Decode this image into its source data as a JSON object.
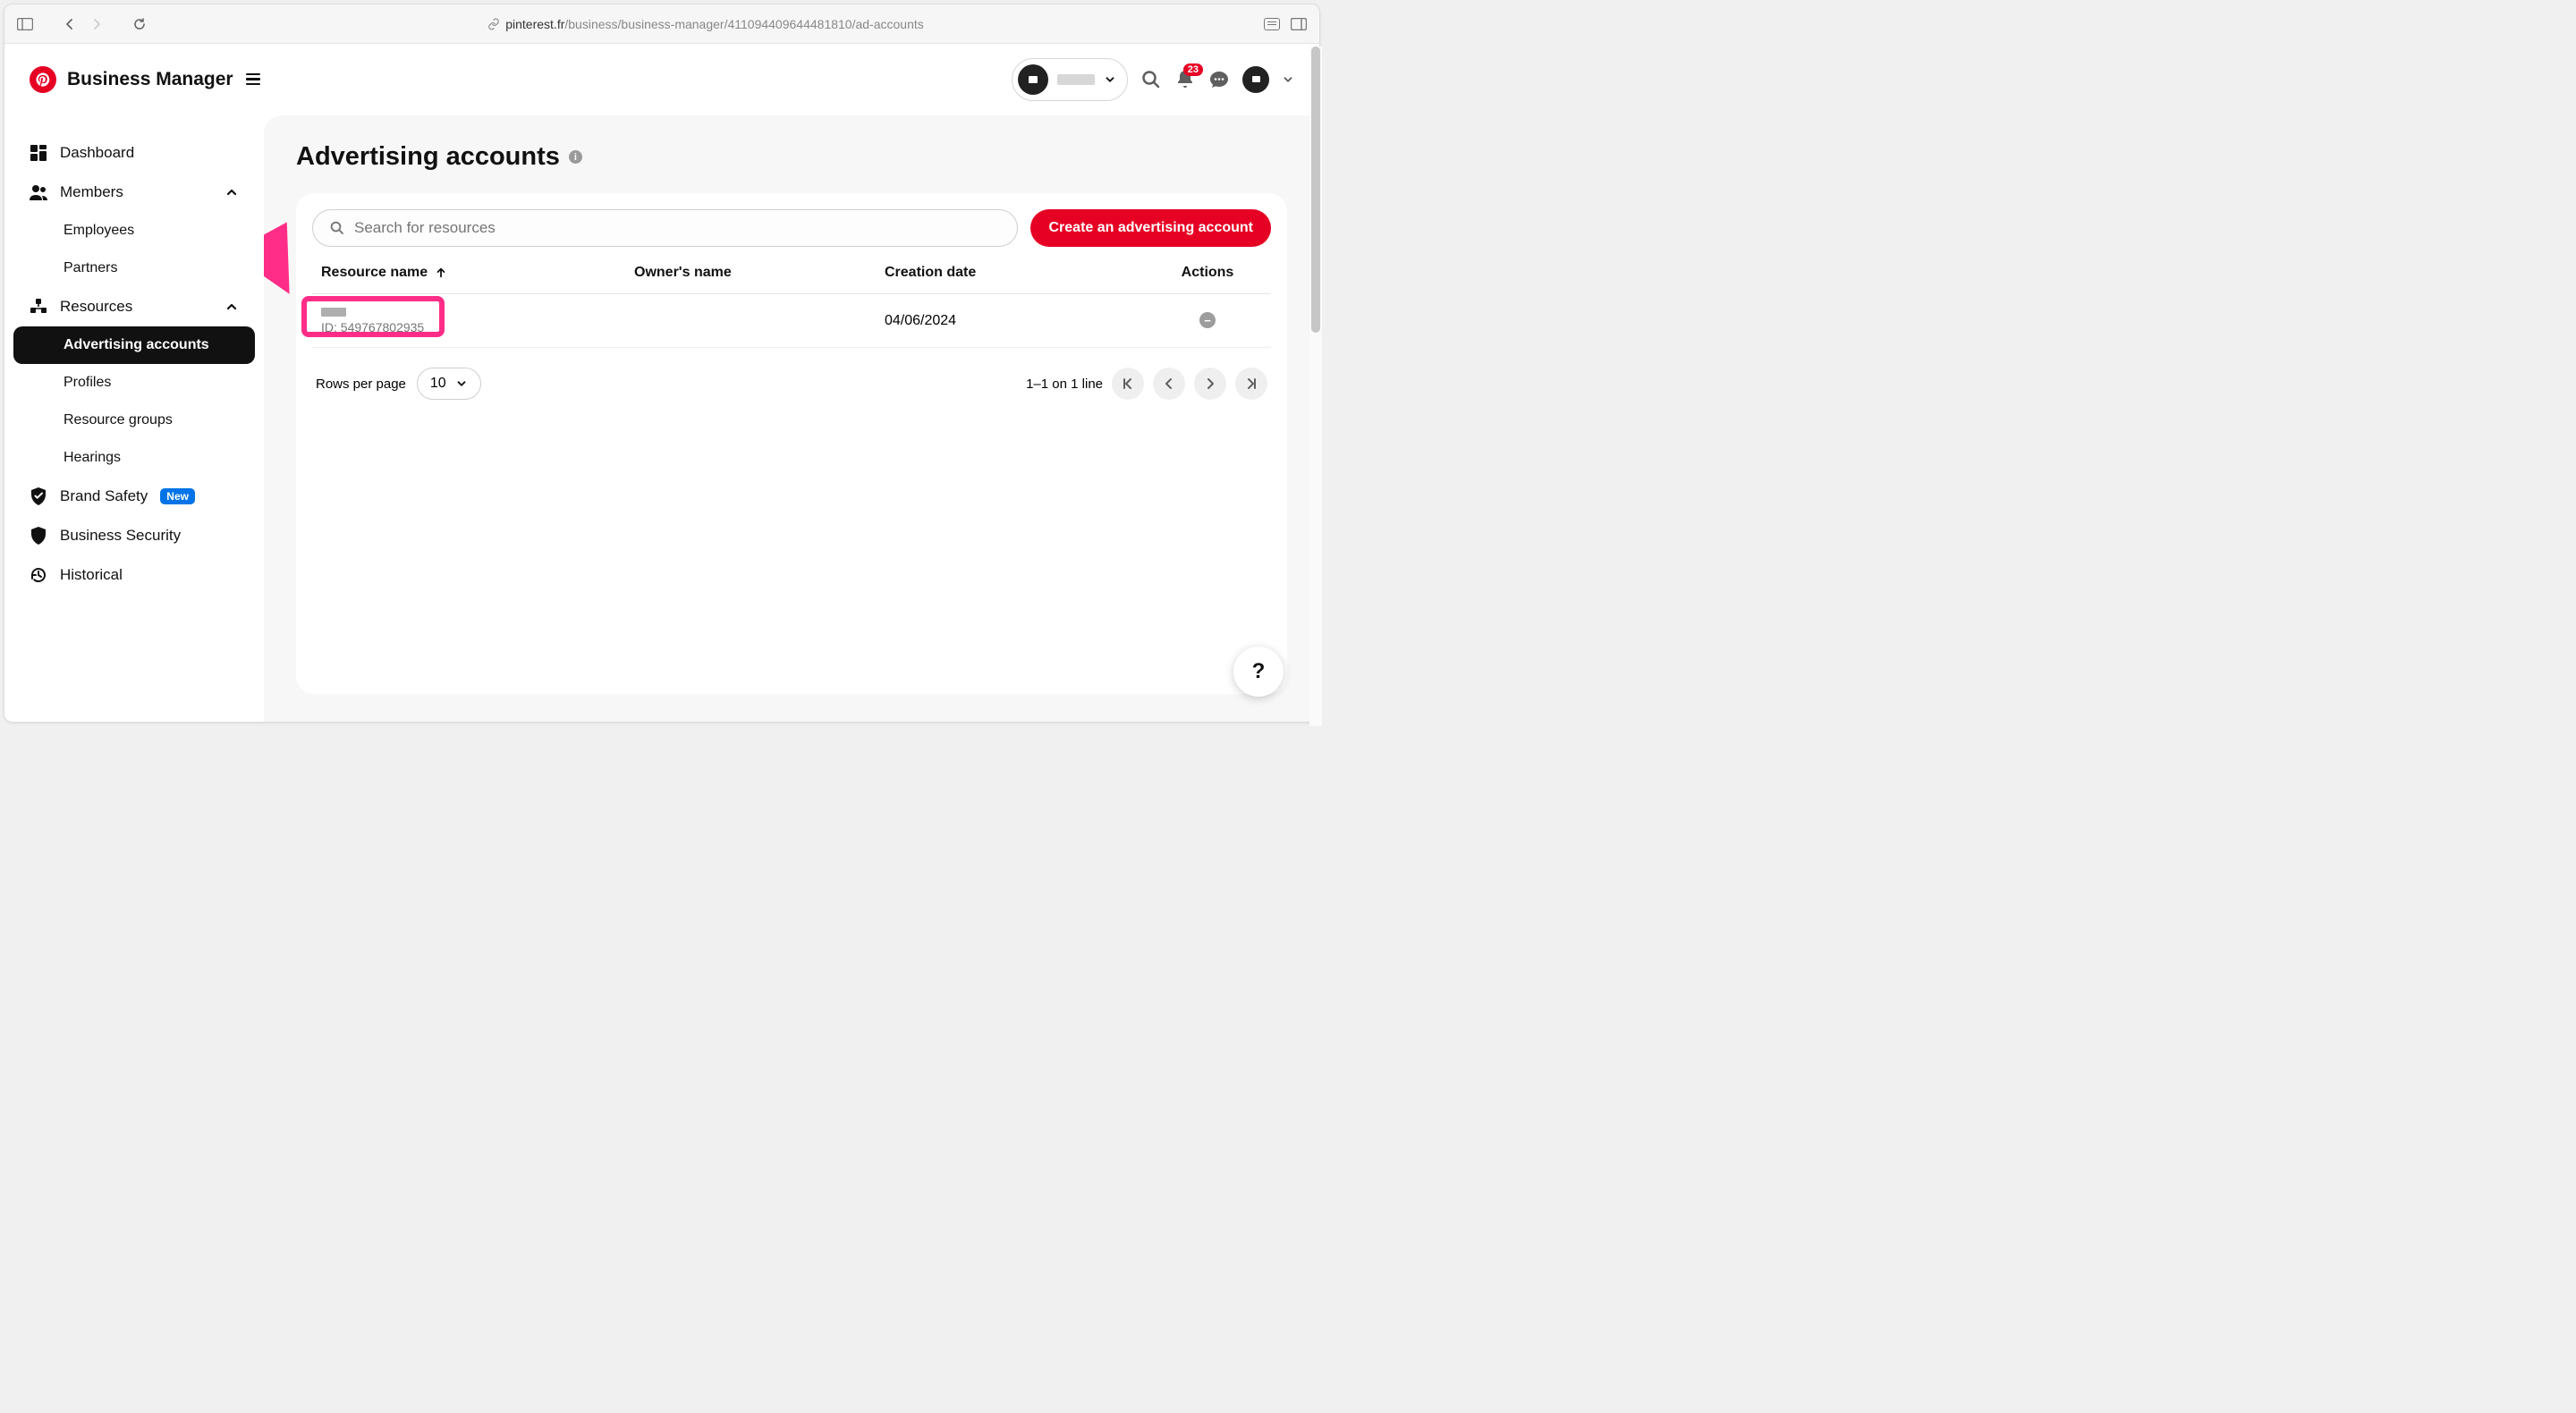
{
  "browser": {
    "url_prefix": "pinterest.fr",
    "url_path": "/business/business-manager/411094409644481810/ad-accounts"
  },
  "header": {
    "app_title": "Business Manager",
    "notification_count": "23"
  },
  "sidebar": {
    "dashboard": "Dashboard",
    "members": "Members",
    "employees": "Employees",
    "partners": "Partners",
    "resources": "Resources",
    "advertising_accounts": "Advertising accounts",
    "profiles": "Profiles",
    "resource_groups": "Resource groups",
    "hearings": "Hearings",
    "brand_safety": "Brand Safety",
    "brand_safety_badge": "New",
    "business_security": "Business Security",
    "historical": "Historical"
  },
  "page": {
    "title": "Advertising accounts",
    "search_placeholder": "Search for resources",
    "create_button": "Create an advertising account"
  },
  "table": {
    "columns": {
      "resource": "Resource name",
      "owner": "Owner's name",
      "date": "Creation date",
      "actions": "Actions"
    },
    "rows": [
      {
        "id_label": "ID: 549767802935",
        "owner": "",
        "date": "04/06/2024"
      }
    ]
  },
  "pager": {
    "rows_label": "Rows per page",
    "rows_value": "10",
    "range": "1–1 on 1 line"
  }
}
